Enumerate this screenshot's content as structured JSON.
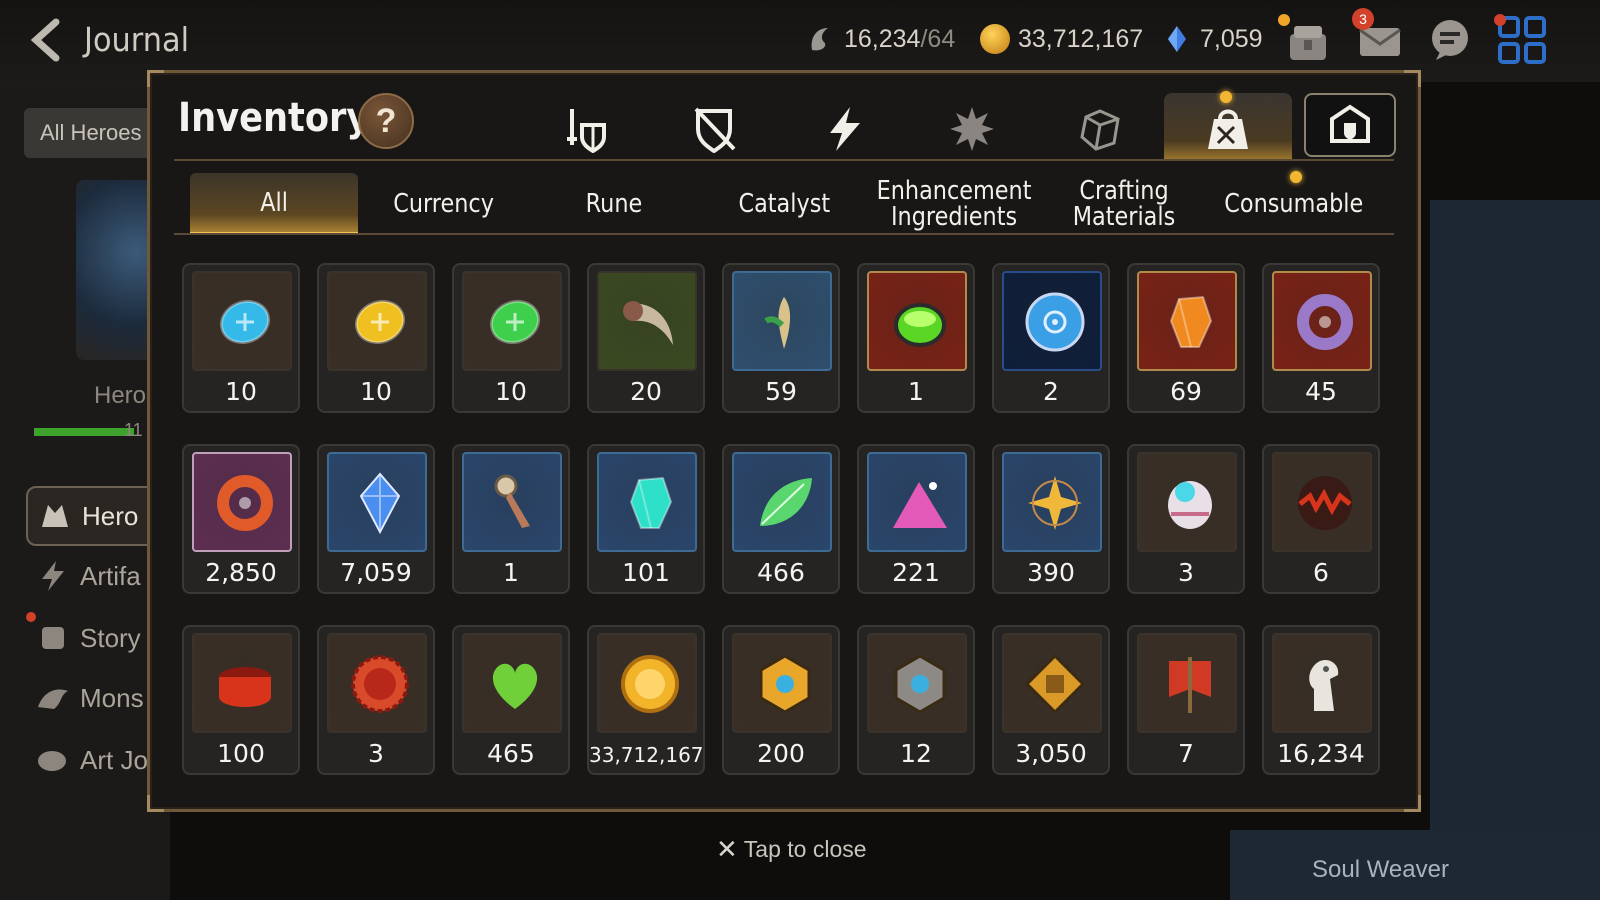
{
  "topbar": {
    "title": "Journal",
    "stamina_value": "16,234",
    "stamina_cap": "/64",
    "gold_value": "33,712,167",
    "skystone_value": "7,059",
    "mail_badge": "3"
  },
  "left_panel": {
    "all_heroes_label": "All Heroes",
    "hero_label": "Hero",
    "hero_bar_number": "11",
    "menu": [
      "Hero",
      "Artifa",
      "Story",
      "Mons",
      "Art Jo"
    ]
  },
  "right_panel": {
    "soul_weaver_label": "Soul Weaver"
  },
  "close_hint": "Tap to close",
  "inventory": {
    "title": "Inventory",
    "help_label": "?",
    "category_icons": [
      "equipment-icon",
      "shield-crossed-icon",
      "artifact-lightning-icon",
      "material-spiky-icon",
      "dice-icon",
      "bag-icon"
    ],
    "active_category": 5,
    "subtabs": [
      {
        "label": "All"
      },
      {
        "label": "Currency"
      },
      {
        "label": "Rune"
      },
      {
        "label": "Catalyst"
      },
      {
        "label": "Enhancement Ingredients"
      },
      {
        "label": "Crafting Materials"
      },
      {
        "label": "Consumable"
      }
    ],
    "active_subtab": 0,
    "items": [
      {
        "name": "blue-rune",
        "count": "10",
        "bg": "#3a2f26",
        "frame": "#3a332c",
        "color": "#35b9e8",
        "shape": "oval"
      },
      {
        "name": "yellow-rune",
        "count": "10",
        "bg": "#3a2f26",
        "frame": "#3a332c",
        "color": "#f0c020",
        "shape": "oval"
      },
      {
        "name": "green-rune",
        "count": "10",
        "bg": "#3a2f26",
        "frame": "#3a332c",
        "color": "#3ed04c",
        "shape": "oval"
      },
      {
        "name": "claw",
        "count": "20",
        "bg": "#3b4a22",
        "frame": "#3a332c",
        "color": "#8a5a48",
        "shape": "claw"
      },
      {
        "name": "ginseng-root",
        "count": "59",
        "bg": "#2f4f6e",
        "frame": "#3d6b94",
        "color": "#d8c28a",
        "shape": "root"
      },
      {
        "name": "green-jar",
        "count": "1",
        "bg": "#7a2216",
        "frame": "#b08a4a",
        "color": "#5ad624",
        "shape": "jar"
      },
      {
        "name": "blue-rune-disc",
        "count": "2",
        "bg": "#0e1e3a",
        "frame": "#2a4d8a",
        "color": "#3b9fe6",
        "shape": "disc"
      },
      {
        "name": "fire-crystal",
        "count": "69",
        "bg": "#7a2216",
        "frame": "#b08a4a",
        "color": "#f08a20",
        "shape": "crystal"
      },
      {
        "name": "eye-pendant",
        "count": "45",
        "bg": "#7a2216",
        "frame": "#b08a4a",
        "color": "#9a7ac8",
        "shape": "ring"
      },
      {
        "name": "red-ring",
        "count": "2,850",
        "bg": "#5e2e52",
        "frame": "#c0a0b8",
        "color": "#e05a2a",
        "shape": "ring"
      },
      {
        "name": "sky-gem",
        "count": "7,059",
        "bg": "#2a466c",
        "frame": "#3d6b94",
        "color": "#4a8ef0",
        "shape": "gem"
      },
      {
        "name": "bookmark-dagger",
        "count": "1",
        "bg": "#2a466c",
        "frame": "#3d6b94",
        "color": "#b87a5a",
        "shape": "dagger"
      },
      {
        "name": "teal-crystal",
        "count": "101",
        "bg": "#2a466c",
        "frame": "#3d6b94",
        "color": "#2ee0c8",
        "shape": "crystal"
      },
      {
        "name": "green-leaf",
        "count": "466",
        "bg": "#2a466c",
        "frame": "#3d6b94",
        "color": "#5ad66e",
        "shape": "leaf"
      },
      {
        "name": "pink-powder",
        "count": "221",
        "bg": "#2a466c",
        "frame": "#3d6b94",
        "color": "#e45ab8",
        "shape": "pile"
      },
      {
        "name": "star-compass",
        "count": "390",
        "bg": "#2a466c",
        "frame": "#3d6b94",
        "color": "#f0b83a",
        "shape": "star"
      },
      {
        "name": "pet-capsule",
        "count": "3",
        "bg": "#3a2f26",
        "frame": "#3a332c",
        "color": "#e8e0e6",
        "shape": "capsule"
      },
      {
        "name": "fire-orb",
        "count": "6",
        "bg": "#3a2f26",
        "frame": "#3a332c",
        "color": "#d8341c",
        "shape": "orb"
      },
      {
        "name": "red-band",
        "count": "100",
        "bg": "#3a2f26",
        "frame": "#3a332c",
        "color": "#d8341c",
        "shape": "band"
      },
      {
        "name": "red-seal",
        "count": "3",
        "bg": "#3a2f26",
        "frame": "#3a332c",
        "color": "#d84a2a",
        "shape": "seal"
      },
      {
        "name": "green-heart",
        "count": "465",
        "bg": "#3a2f26",
        "frame": "#3a332c",
        "color": "#6fd03a",
        "shape": "heart"
      },
      {
        "name": "gold-coin",
        "count": "33,712,167",
        "bg": "#3a2f26",
        "frame": "#3a332c",
        "color": "#f2b52a",
        "shape": "coin",
        "small": true
      },
      {
        "name": "gold-hex-medal",
        "count": "200",
        "bg": "#3a2f26",
        "frame": "#3a332c",
        "color": "#e8a62a",
        "shape": "hex"
      },
      {
        "name": "stone-compass",
        "count": "12",
        "bg": "#3a2f26",
        "frame": "#3a332c",
        "color": "#8d8a86",
        "shape": "hex"
      },
      {
        "name": "fist-emblem",
        "count": "3,050",
        "bg": "#3a2f26",
        "frame": "#3a332c",
        "color": "#d99a28",
        "shape": "diamond"
      },
      {
        "name": "war-banner",
        "count": "7",
        "bg": "#3a2f26",
        "frame": "#3a332c",
        "color": "#d03a24",
        "shape": "banner"
      },
      {
        "name": "horse-head",
        "count": "16,234",
        "bg": "#3a2f26",
        "frame": "#3a332c",
        "color": "#e8e4de",
        "shape": "horse"
      }
    ]
  }
}
